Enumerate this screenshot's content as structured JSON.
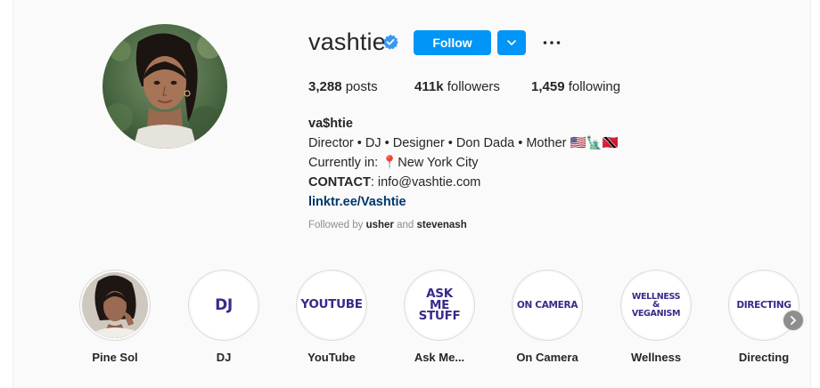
{
  "profile": {
    "username": "vashtie",
    "follow_label": "Follow",
    "stats": {
      "posts_count": "3,288",
      "posts_label": "posts",
      "followers_count": "411k",
      "followers_label": "followers",
      "following_count": "1,459",
      "following_label": "following"
    },
    "bio": {
      "name": "va$htie",
      "line1": "Director • DJ • Designer • Don Dada • Mother 🇺🇸🗽🇹🇹",
      "line2": "Currently in: 📍New York City",
      "contact_label": "CONTACT",
      "contact_value": ": info@vashtie.com",
      "link": "linktr.ee/Vashtie"
    },
    "followed_by": {
      "prefix": "Followed by ",
      "user1": "usher",
      "joiner": " and ",
      "user2": "stevenash"
    }
  },
  "highlights": [
    {
      "label": "Pine Sol",
      "cover": ""
    },
    {
      "label": "DJ",
      "cover": "DJ"
    },
    {
      "label": "YouTube",
      "cover": "YOUTUBE"
    },
    {
      "label": "Ask Me...",
      "cover": "ASK\nME\nSTUFF"
    },
    {
      "label": "On Camera",
      "cover": "ON CAMERA"
    },
    {
      "label": "Wellness",
      "cover": "WELLNESS\n&\nVEGANISM"
    },
    {
      "label": "Directing",
      "cover": "DIRECTING"
    }
  ],
  "colors": {
    "accent": "#0095f6",
    "link": "#00376b",
    "highlight_text": "#3a2a8a",
    "muted": "#8e8e8e"
  },
  "icons": {
    "verified": "verified-badge-icon",
    "dropdown": "chevron-down-icon",
    "more": "more-options-icon",
    "next": "chevron-right-icon"
  }
}
